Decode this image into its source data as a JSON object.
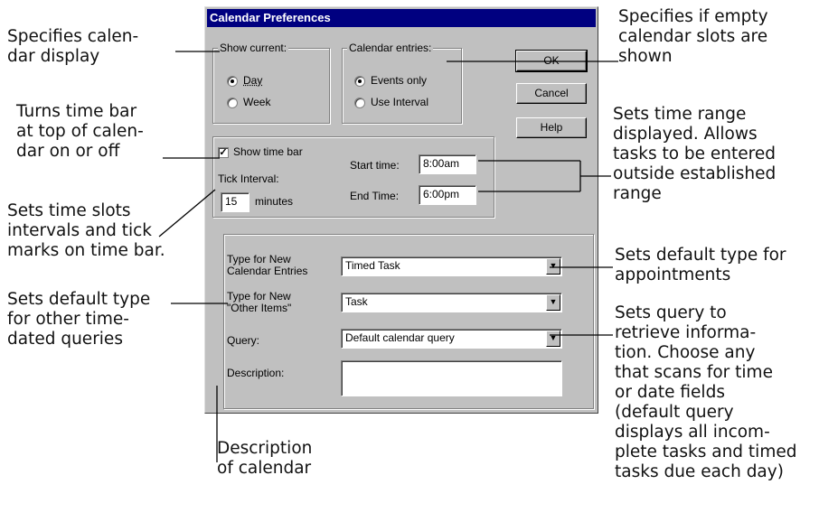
{
  "dialog": {
    "title": "Calendar Preferences",
    "show_current": {
      "legend": "Show current:",
      "options": [
        "Day",
        "Week"
      ],
      "selected": "Day"
    },
    "calendar_entries": {
      "legend": "Calendar entries:",
      "options": [
        "Events only",
        "Use Interval"
      ],
      "selected": "Events only"
    },
    "buttons": {
      "ok": "OK",
      "cancel": "Cancel",
      "help": "Help"
    },
    "time_bar": {
      "show_label": "Show time bar",
      "checked": true,
      "tick_interval_label": "Tick Interval:",
      "tick_interval_value": "15",
      "tick_interval_unit": "minutes",
      "start_label": "Start time:",
      "start_value": "8:00am",
      "end_label": "End Time:",
      "end_value": "6:00pm"
    },
    "types": {
      "new_calendar_label": "Type for New\nCalendar Entries",
      "new_calendar_value": "Timed Task",
      "new_other_label": "Type for New\n\"Other Items\"",
      "new_other_value": "Task",
      "query_label": "Query:",
      "query_value": "Default calendar query",
      "description_label": "Description:",
      "description_value": ""
    }
  },
  "annotations": {
    "calendar_display": "Specifies calen-\ndar display",
    "time_bar_toggle": "Turns time bar\nat top of calen-\ndar on or off",
    "tick_intervals": "Sets time slots\nintervals and tick\nmarks on time bar.",
    "default_other": "Sets default type\nfor other time-\ndated queries",
    "empty_slots": "Specifies if empty\ncalendar slots are\nshown",
    "time_range": "Sets time range\ndisplayed. Allows\ntasks to be entered\noutside established\nrange",
    "default_appointments": "Sets default type for\nappointments",
    "query": "Sets query to\nretrieve informa-\ntion. Choose any\nthat scans for time\nor date fields\n(default query\ndisplays all incom-\nplete tasks and timed\ntasks due each day)",
    "description": "Description\nof calendar"
  },
  "colors": {
    "title_bar": "#000080",
    "dialog_face": "#c0c0c0"
  }
}
